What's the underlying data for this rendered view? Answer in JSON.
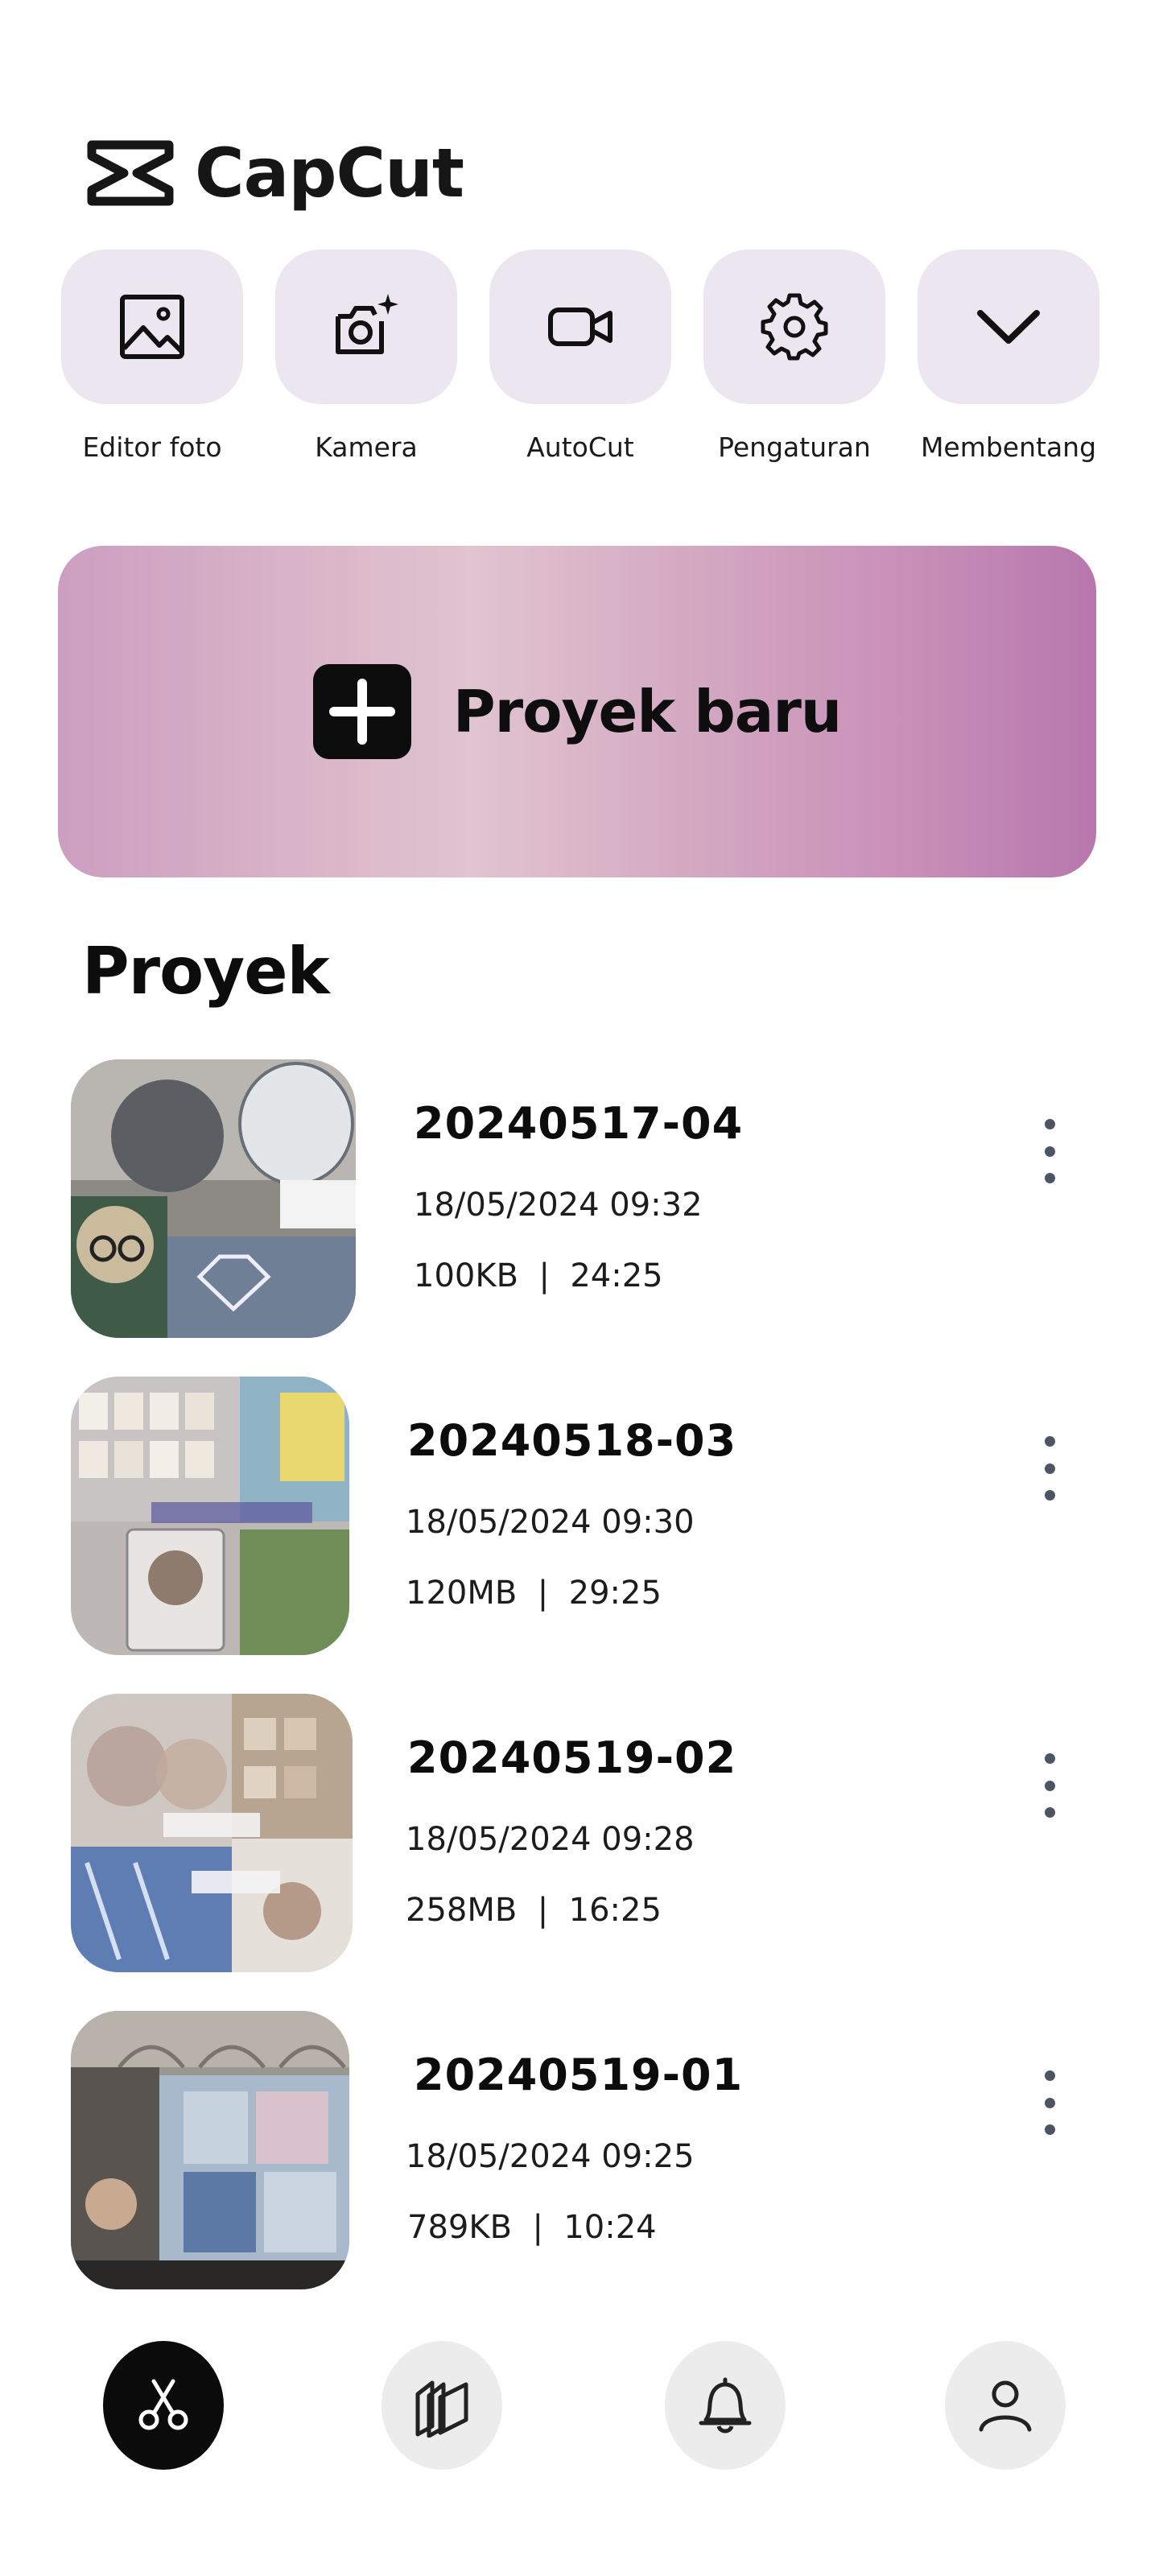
{
  "app": {
    "logo_text": "CapCut"
  },
  "quick_actions": [
    {
      "label": "Editor foto",
      "icon": "image-icon"
    },
    {
      "label": "Kamera",
      "icon": "camera-sparkle-icon"
    },
    {
      "label": "AutoCut",
      "icon": "video-camera-icon"
    },
    {
      "label": "Pengaturan",
      "icon": "gear-icon"
    },
    {
      "label": "Membentang",
      "icon": "chevron-down-icon"
    }
  ],
  "new_project": {
    "label": "Proyek baru",
    "icon": "plus-icon"
  },
  "projects_section": {
    "title": "Proyek"
  },
  "projects": [
    {
      "title": "20240517-04",
      "date": "18/05/2024 09:32",
      "meta": "100KB  |  24:25"
    },
    {
      "title": "20240518-03",
      "date": "18/05/2024 09:30",
      "meta": "120MB  |  29:25"
    },
    {
      "title": "20240519-02",
      "date": "18/05/2024 09:28",
      "meta": "258MB  |  16:25"
    },
    {
      "title": "20240519-01",
      "date": "18/05/2024 09:25",
      "meta": "789KB  |  10:24"
    }
  ],
  "bottom_nav": [
    {
      "icon": "scissors-icon",
      "active": true
    },
    {
      "icon": "templates-icon",
      "active": false
    },
    {
      "icon": "bell-icon",
      "active": false
    },
    {
      "icon": "user-icon",
      "active": false
    }
  ],
  "colors": {
    "tile_bg": "#ece6f1",
    "banner_start": "#cc9ec0",
    "banner_end": "#b777ad",
    "nav_active": "#0b0b0b",
    "nav_inactive": "#ececec"
  }
}
